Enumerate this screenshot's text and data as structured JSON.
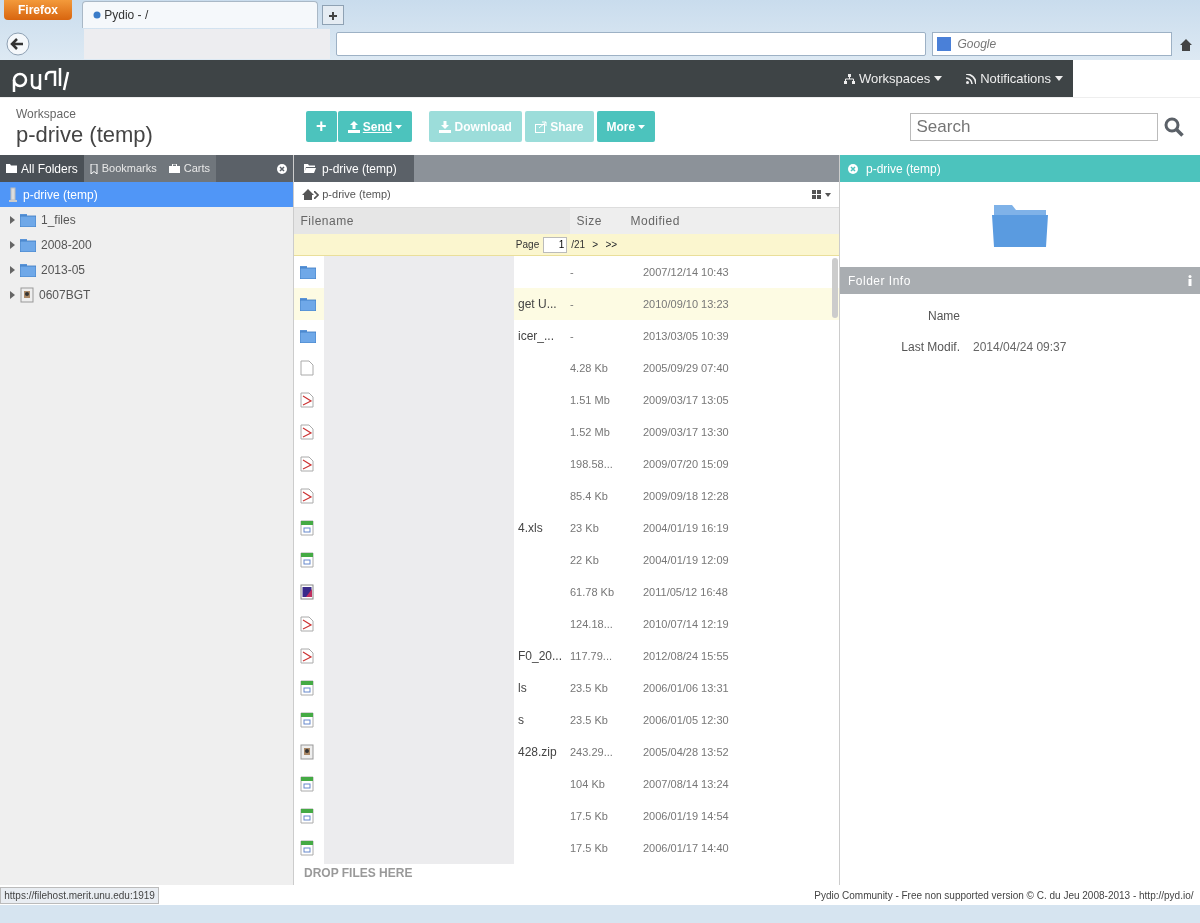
{
  "browser": {
    "menu_button": "Firefox",
    "tabs": [
      {
        "title": "Pydio - /",
        "selected": true
      }
    ],
    "search_placeholder": "Google"
  },
  "navbar": {
    "items": [
      {
        "label": "Workspaces",
        "kind": "workspaces"
      },
      {
        "label": "Notifications",
        "kind": "notifications"
      }
    ]
  },
  "header": {
    "label": "Workspace",
    "title": "p-drive (temp)",
    "search_placeholder": "Search",
    "toolbar": [
      {
        "kind": "plus",
        "label": "+",
        "disabled": false
      },
      {
        "kind": "upload",
        "label": "Send",
        "disabled": false
      },
      {
        "kind": "download",
        "label": "Download",
        "disabled": true
      },
      {
        "kind": "share",
        "label": "Share",
        "disabled": true
      },
      {
        "kind": "more",
        "label": "More",
        "disabled": false
      }
    ]
  },
  "sidebar": {
    "tabs": [
      {
        "label": "All Folders",
        "kind": "folder",
        "selected": true
      },
      {
        "label": "Bookmarks",
        "kind": "bookmark",
        "selected": false
      },
      {
        "label": "Carts",
        "kind": "cart",
        "selected": false
      }
    ],
    "tree": [
      {
        "label": "p-drive (temp)",
        "kind": "drive",
        "selected": true,
        "children": [
          {
            "label": "1_files",
            "kind": "folder",
            "selected": false
          },
          {
            "label": "2008-200",
            "kind": "folder",
            "selected": false
          },
          {
            "label": "2013-05",
            "kind": "folder",
            "selected": false
          },
          {
            "label": "0607BGT",
            "kind": "archive",
            "selected": false
          }
        ]
      }
    ]
  },
  "file_list": {
    "tab": "p-drive (temp)",
    "breadcrumb": "p-drive (temp)",
    "columns": [
      "Filename",
      "Size",
      "Modified"
    ],
    "pager": {
      "label": "Page",
      "value": "1",
      "total": "/21",
      "next": ">",
      "last": ">>"
    },
    "rows": [
      {
        "kind": "folder",
        "size": "-",
        "modified": "2007/12/14 10:43",
        "selected": false
      },
      {
        "kind": "folder",
        "name": "get U...",
        "size": "-",
        "modified": "2010/09/10 13:23",
        "selected": true
      },
      {
        "kind": "folder",
        "name": "icer_...",
        "size": "-",
        "modified": "2013/03/05 10:39",
        "selected": false
      },
      {
        "kind": "file",
        "size": "4.28 Kb",
        "modified": "2005/09/29 07:40",
        "selected": false
      },
      {
        "kind": "pdf",
        "size": "1.51 Mb",
        "modified": "2009/03/17 13:05",
        "selected": false
      },
      {
        "kind": "pdf",
        "size": "1.52 Mb",
        "modified": "2009/03/17 13:30",
        "selected": false
      },
      {
        "kind": "pdf",
        "size": "198.58...",
        "modified": "2009/07/20 15:09",
        "selected": false
      },
      {
        "kind": "pdf",
        "size": "85.4 Kb",
        "modified": "2009/09/18 12:28",
        "selected": false
      },
      {
        "kind": "sheet",
        "name": "4.xls",
        "size": "23 Kb",
        "modified": "2004/01/19 16:19",
        "selected": false
      },
      {
        "kind": "sheet",
        "size": "22 Kb",
        "modified": "2004/01/19 12:09",
        "selected": false
      },
      {
        "kind": "image",
        "size": "61.78 Kb",
        "modified": "2011/05/12 16:48",
        "selected": false
      },
      {
        "kind": "pdf",
        "size": "124.18...",
        "modified": "2010/07/14 12:19",
        "selected": false
      },
      {
        "kind": "pdf",
        "name": "F0_20...",
        "size": "117.79...",
        "modified": "2012/08/24 15:55",
        "selected": false
      },
      {
        "kind": "sheet",
        "name": "ls",
        "size": "23.5 Kb",
        "modified": "2006/01/06 13:31",
        "selected": false
      },
      {
        "kind": "sheet",
        "name": "s",
        "size": "23.5 Kb",
        "modified": "2006/01/05 12:30",
        "selected": false
      },
      {
        "kind": "archive",
        "name": "428.zip",
        "size": "243.29...",
        "modified": "2005/04/28 13:52",
        "selected": false
      },
      {
        "kind": "sheet",
        "size": "104 Kb",
        "modified": "2007/08/14 13:24",
        "selected": false
      },
      {
        "kind": "sheet",
        "size": "17.5 Kb",
        "modified": "2006/01/19 14:54",
        "selected": false
      },
      {
        "kind": "sheet",
        "size": "17.5 Kb",
        "modified": "2006/01/17 14:40",
        "selected": false
      }
    ],
    "drop_hint": "DROP FILES HERE"
  },
  "info_panel": {
    "title": "p-drive (temp)",
    "section": "Folder Info",
    "fields": [
      {
        "label": "Name"
      },
      {
        "label": "Last Modif.",
        "value": "2014/04/24 09:37"
      }
    ]
  },
  "status_bar": {
    "url": "https://filehost.merit.unu.edu:1919",
    "footer": "Pydio Community - Free non supported version © C. du Jeu 2008-2013 - http://pyd.io/"
  }
}
